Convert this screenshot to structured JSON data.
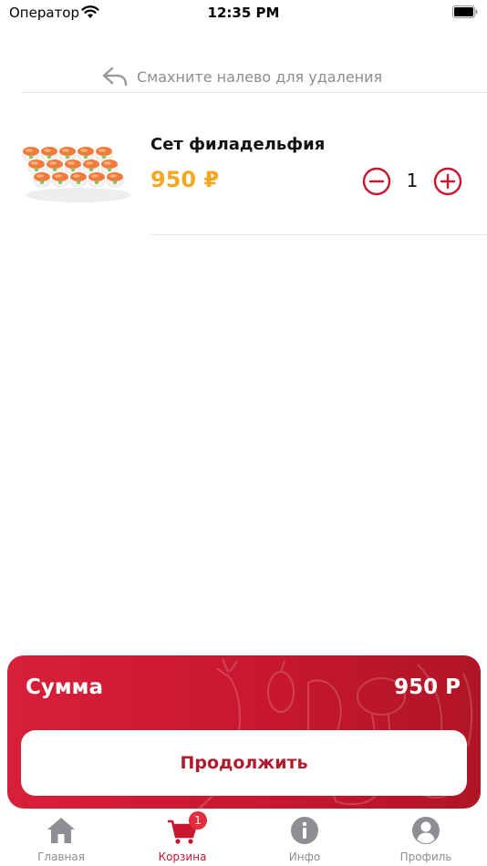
{
  "status_bar": {
    "carrier": "Оператор",
    "time": "12:35 PM"
  },
  "swipe_hint": {
    "text": "Смахните налево для удаления",
    "icon": "reply-arrow-icon"
  },
  "cart": {
    "items": [
      {
        "name": "Сет филадельфия",
        "price": "950 ₽",
        "quantity": "1",
        "image": "sushi-set-image"
      }
    ]
  },
  "summary": {
    "label": "Сумма",
    "value": "950 Р",
    "continue_label": "Продолжить"
  },
  "tabs": [
    {
      "label": "Главная",
      "icon": "home-icon"
    },
    {
      "label": "Корзина",
      "icon": "cart-icon",
      "badge": "1",
      "active": true
    },
    {
      "label": "Инфо",
      "icon": "info-icon"
    },
    {
      "label": "Профиль",
      "icon": "profile-icon"
    }
  ],
  "colors": {
    "accent": "#c8172f",
    "price": "#f5a623",
    "inactive_tab": "#8e8e93"
  }
}
